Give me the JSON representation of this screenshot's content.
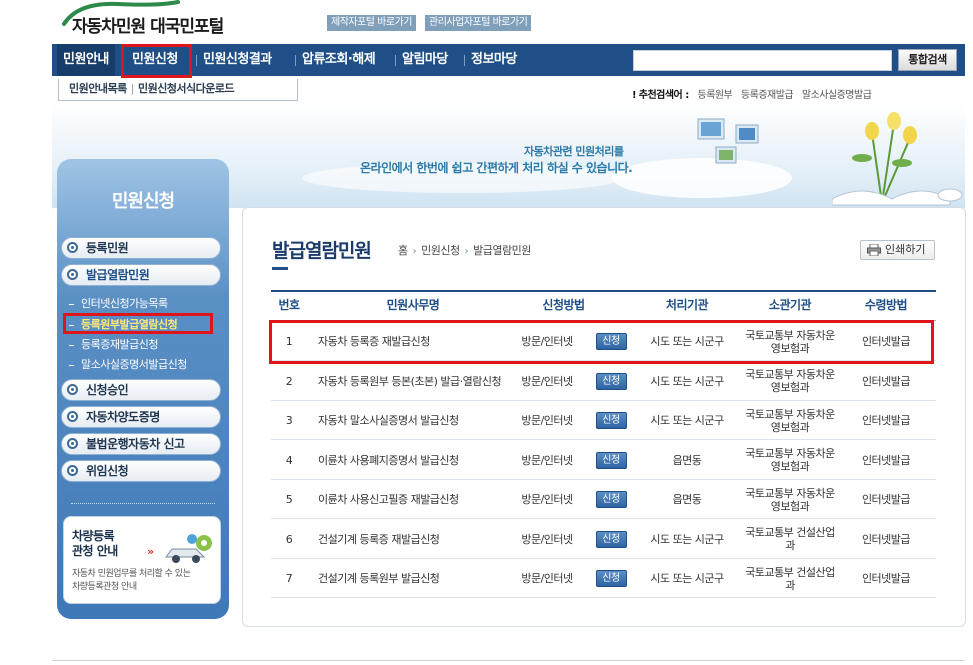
{
  "header": {
    "logo_text": "자동차민원 대국민포털",
    "links": [
      "제작자포털 바로가기",
      "관리사업자포털 바로가기"
    ]
  },
  "nav": {
    "items": [
      "민원안내",
      "민원신청",
      "민원신청결과",
      "압류조회·해제",
      "알림마당",
      "정보마당"
    ],
    "search_button": "통합검색"
  },
  "subnav": {
    "items": [
      "민원안내목록",
      "민원신청서식다운로드"
    ]
  },
  "recommend": {
    "label": "추천검색어 :",
    "keywords": [
      "등록원부",
      "등록증재발급",
      "말소사실증명발급"
    ]
  },
  "banner": {
    "line1": "자동차관련 민원처리를",
    "line2": "온라인에서 한번에 쉽고 간편하게 처리 하실 수 있습니다."
  },
  "sidebar": {
    "title": "민원신청",
    "items": [
      "등록민원",
      "발급열람민원",
      "신청승인",
      "자동차양도증명",
      "불법운행자동차 신고",
      "위임신청"
    ],
    "subitems": [
      "인터넷신청가능목록",
      "등록원부발급열람신청",
      "등록증재발급신청",
      "말소사실증명서발급신청"
    ],
    "box": {
      "title_line1": "차량등록",
      "title_line2": "관청 안내",
      "desc_line1": "자동차 민원업무를 처리할 수 있는",
      "desc_line2": "차량등록관청 안내"
    }
  },
  "content": {
    "title": "발급열람민원",
    "breadcrumb": [
      "홈",
      "민원신청",
      "발급열람민원"
    ],
    "print_label": "인쇄하기",
    "table": {
      "headers": [
        "번호",
        "민원사무명",
        "신청방법",
        "처리기관",
        "소관기관",
        "수령방법"
      ],
      "rows": [
        {
          "no": "1",
          "name": "자동차 등록증 재발급신청",
          "method": "방문/인터넷",
          "btn": "신청",
          "org": "시도 또는 시군구",
          "dept": "국토교통부 자동차운영보험과",
          "recv": "인터넷발급"
        },
        {
          "no": "2",
          "name": "자동차 등록원부 등본(초본) 발급·열람신청",
          "method": "방문/인터넷",
          "btn": "신청",
          "org": "시도 또는 시군구",
          "dept": "국토교통부 자동차운영보험과",
          "recv": "인터넷발급"
        },
        {
          "no": "3",
          "name": "자동차 말소사실증명서 발급신청",
          "method": "방문/인터넷",
          "btn": "신청",
          "org": "시도 또는 시군구",
          "dept": "국토교통부 자동차운영보험과",
          "recv": "인터넷발급"
        },
        {
          "no": "4",
          "name": "이륜차 사용폐지증명서 발급신청",
          "method": "방문/인터넷",
          "btn": "신청",
          "org": "읍면동",
          "dept": "국토교통부 자동차운영보험과",
          "recv": "인터넷발급"
        },
        {
          "no": "5",
          "name": "이륜차 사용신고필증 재발급신청",
          "method": "방문/인터넷",
          "btn": "신청",
          "org": "읍면동",
          "dept": "국토교통부 자동차운영보험과",
          "recv": "인터넷발급"
        },
        {
          "no": "6",
          "name": "건설기계 등록증 재발급신청",
          "method": "방문/인터넷",
          "btn": "신청",
          "org": "시도 또는 시군구",
          "dept": "국토교통부 건설산업과",
          "recv": "인터넷발급"
        },
        {
          "no": "7",
          "name": "건설기계 등록원부 발급신청",
          "method": "방문/인터넷",
          "btn": "신청",
          "org": "시도 또는 시군구",
          "dept": "국토교통부 건설산업과",
          "recv": "인터넷발급"
        }
      ]
    }
  },
  "colors": {
    "nav_bg": "#1f4f86",
    "highlight": "#e0141b",
    "title": "#1a3b6b"
  }
}
